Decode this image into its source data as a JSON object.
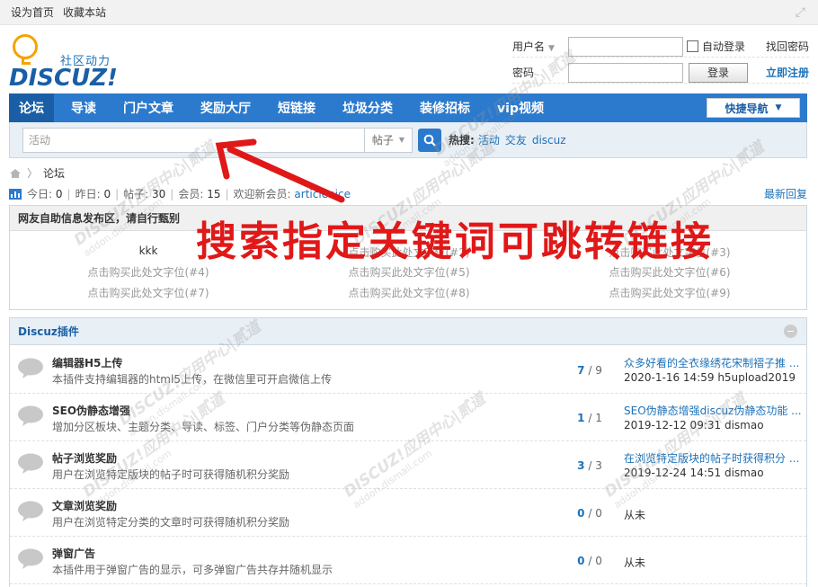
{
  "topbar": {
    "set_home": "设为首页",
    "bookmark": "收藏本站"
  },
  "logo": {
    "tagline": "社区动力",
    "brand": "DISCUZ!"
  },
  "login": {
    "username_label": "用户名",
    "password_label": "密码",
    "remember_label": "自动登录",
    "find_password": "找回密码",
    "login_button": "登录",
    "register": "立即注册"
  },
  "nav": {
    "items": [
      "论坛",
      "导读",
      "门户文章",
      "奖励大厅",
      "短链接",
      "垃圾分类",
      "装修招标",
      "vip视频"
    ],
    "active": 0,
    "quick_nav": "快捷导航",
    "color": "#2b7acd"
  },
  "search": {
    "placeholder": "活动",
    "scope": "帖子",
    "hot_label": "热搜:",
    "hot_words": [
      "活动",
      "交友",
      "discuz"
    ]
  },
  "breadcrumb": {
    "current": "论坛"
  },
  "stats": {
    "today_label": "今日:",
    "today": "0",
    "yesterday_label": "昨日:",
    "yesterday": "0",
    "posts_label": "帖子:",
    "posts": "30",
    "members_label": "会员:",
    "members": "15",
    "newest_label": "欢迎新会员:",
    "newest_user": "articlenice",
    "latest_replies": "最新回复"
  },
  "adbox": {
    "title": "网友自助信息发布区，请自行甄别",
    "cells": [
      "kkk",
      "点击购买此处文字位(#2)",
      "点击购买此处文字位(#3)",
      "点击购买此处文字位(#4)",
      "点击购买此处文字位(#5)",
      "点击购买此处文字位(#6)",
      "点击购买此处文字位(#7)",
      "点击购买此处文字位(#8)",
      "点击购买此处文字位(#9)"
    ]
  },
  "annotation": {
    "text": "搜索指定关键词可跳转链接",
    "color": "#e01818"
  },
  "plugins": {
    "title": "Discuz插件",
    "rows": [
      {
        "title": "编辑器H5上传",
        "desc": "本插件支持编辑器的html5上传，在微信里可开启微信上传",
        "threads": "7",
        "posts": "9",
        "last_title": "众多好看的全衣缘绣花宋制褶子推 ...",
        "last_meta": "2020-1-16 14:59 h5upload2019"
      },
      {
        "title": "SEO伪静态增强",
        "desc": "增加分区板块、主题分类、导读、标签、门户分类等伪静态页面",
        "threads": "1",
        "posts": "1",
        "last_title": "SEO伪静态增强discuz伪静态功能 ...",
        "last_meta": "2019-12-12 09:31 dismao"
      },
      {
        "title": "帖子浏览奖励",
        "desc": "用户在浏览特定版块的帖子时可获得随机积分奖励",
        "threads": "3",
        "posts": "3",
        "last_title": "在浏览特定版块的帖子时获得积分 ...",
        "last_meta": "2019-12-24 14:51 dismao"
      },
      {
        "title": "文章浏览奖励",
        "desc": "用户在浏览特定分类的文章时可获得随机积分奖励",
        "threads": "0",
        "posts": "0",
        "never": "从未"
      },
      {
        "title": "弹窗广告",
        "desc": "本插件用于弹窗广告的显示，可多弹窗广告共存并随机显示",
        "threads": "0",
        "posts": "0",
        "never": "从未"
      }
    ]
  }
}
